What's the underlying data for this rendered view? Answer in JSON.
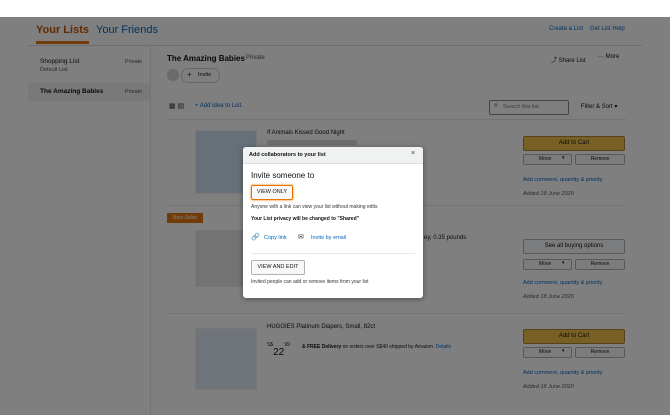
{
  "header": {
    "tab_yours": "Your Lists",
    "tab_friends": "Your Friends",
    "create_list": "Create a List",
    "list_help": "Get List Help"
  },
  "lists": [
    {
      "name": "Shopping List",
      "sub": "Default List",
      "privacy": "Private"
    },
    {
      "name": "The Amazing Babies",
      "sub": "",
      "privacy": "Private"
    }
  ],
  "main": {
    "title": "The Amazing Babies",
    "privacy": "Private",
    "invite_label": "Invite",
    "share_label": "Share List",
    "more_label": "More",
    "add_idea": "+ Add idea to List",
    "search_placeholder": "Search this list",
    "filter_sort": "Filter & Sort"
  },
  "items": [
    {
      "title": "If Animals Kissed Good Night",
      "action": "Add to Cart",
      "move": "Move",
      "remove": "Remove",
      "comment": "Add comment, quantity & priority",
      "added": "Added 18 June 2020"
    },
    {
      "badge": "Best Seller",
      "extra": "ey, 0.35 pounds",
      "action": "See all buying options",
      "move": "Move",
      "remove": "Remove",
      "comment": "Add comment, quantity & priority",
      "added": "Added 18 June 2020"
    },
    {
      "title": "HUGGIES Platinum Diapers, Small, 82ct",
      "price_symbol": "S$",
      "price_whole": "22",
      "price_frac": "99",
      "delivery_bold": "& FREE Delivery",
      "delivery_rest": "on orders over S$40 shipped by Amazon.",
      "details": "Details",
      "action": "Add to Cart",
      "move": "Move",
      "remove": "Remove",
      "comment": "Add comment, quantity & priority",
      "added": "Added 18 June 2020"
    }
  ],
  "modal": {
    "title": "Add collaborators to your list",
    "close": "×",
    "heading": "Invite someone to",
    "view_only": "VIEW ONLY",
    "view_only_desc": "Anyone with a link can view your list without making edits",
    "privacy_notice": "Your List privacy will be changed to \"Shared\"",
    "copy_link": "Copy link",
    "invite_email": "Invite by email",
    "view_edit": "VIEW AND EDIT",
    "view_edit_desc": "Invited people can add or remove items from your list"
  },
  "colors": {
    "accent": "#e47911",
    "link": "#0066c0",
    "cart": "#f0c14b"
  }
}
